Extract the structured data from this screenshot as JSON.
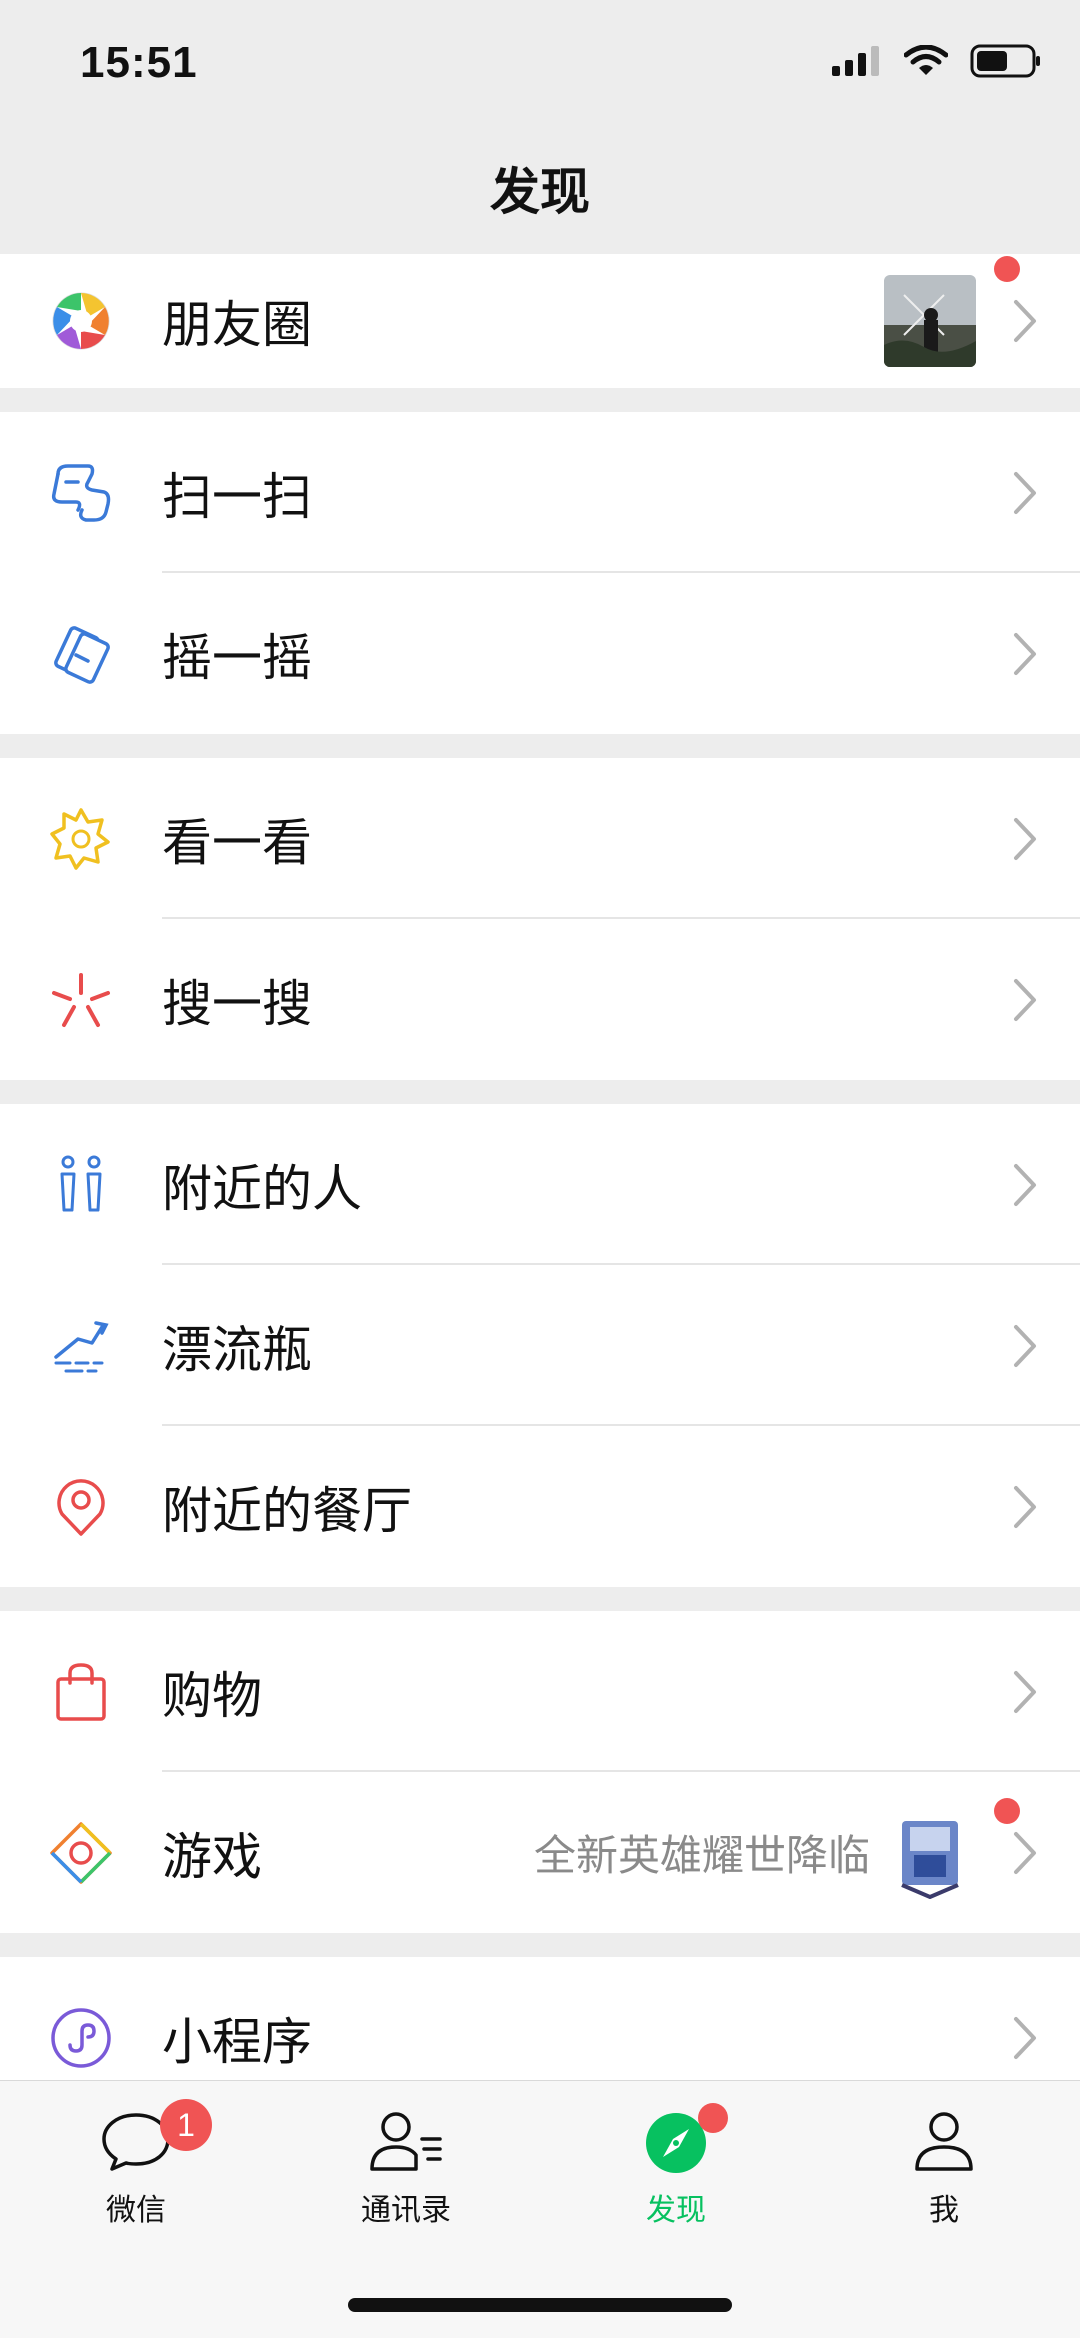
{
  "status_bar": {
    "time": "15:51"
  },
  "header": {
    "title": "发现"
  },
  "groups": [
    {
      "items": [
        {
          "label": "朋友圈",
          "icon": "moments-aperture-icon",
          "has_thumbnail": true,
          "has_dot": true
        }
      ]
    },
    {
      "items": [
        {
          "label": "扫一扫",
          "icon": "scan-icon"
        },
        {
          "label": "摇一摇",
          "icon": "shake-icon"
        }
      ]
    },
    {
      "items": [
        {
          "label": "看一看",
          "icon": "top-stories-icon"
        },
        {
          "label": "搜一搜",
          "icon": "search-star-icon"
        }
      ]
    },
    {
      "items": [
        {
          "label": "附近的人",
          "icon": "people-nearby-icon"
        },
        {
          "label": "漂流瓶",
          "icon": "drift-bottle-icon"
        },
        {
          "label": "附近的餐厅",
          "icon": "location-pin-icon"
        }
      ]
    },
    {
      "items": [
        {
          "label": "购物",
          "icon": "shopping-bag-icon"
        },
        {
          "label": "游戏",
          "icon": "games-icon",
          "subtitle": "全新英雄耀世降临",
          "has_dot": true
        }
      ]
    },
    {
      "items": [
        {
          "label": "小程序",
          "icon": "mini-program-icon"
        }
      ]
    }
  ],
  "tabbar": {
    "tabs": [
      {
        "label": "微信",
        "icon": "chat-bubble-icon",
        "badge": "1"
      },
      {
        "label": "通讯录",
        "icon": "contacts-icon"
      },
      {
        "label": "发现",
        "icon": "discover-compass-icon",
        "active": true,
        "has_dot": true
      },
      {
        "label": "我",
        "icon": "me-person-icon"
      }
    ]
  },
  "colors": {
    "accent": "#07c160",
    "badge": "#f05454",
    "background": "#ededed"
  }
}
